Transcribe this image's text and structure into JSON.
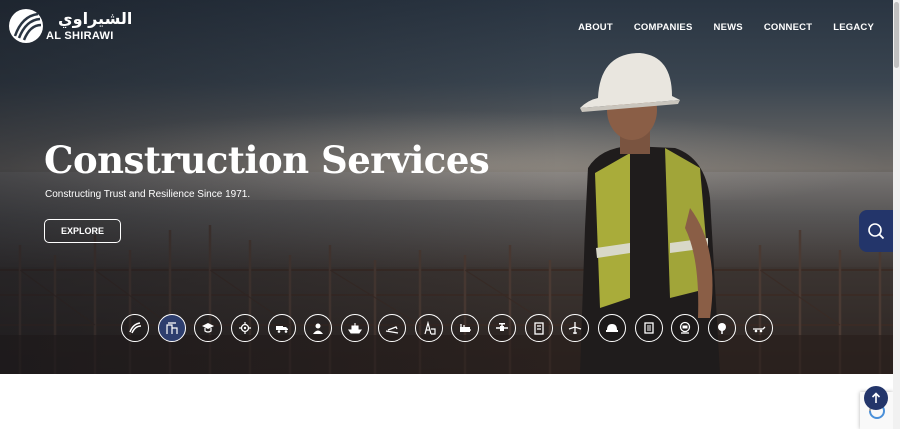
{
  "brand": {
    "name": "AL SHIRAWI",
    "name_arabic": "الشيراوي"
  },
  "nav": {
    "items": [
      "ABOUT",
      "COMPANIES",
      "NEWS",
      "CONNECT",
      "LEGACY"
    ]
  },
  "hero": {
    "title": "Construction Services",
    "subtitle": "Constructing Trust and Resilience Since 1971.",
    "cta_label": "EXPLORE"
  },
  "categories": {
    "active_index": 1,
    "icons": [
      "brand-swoosh-icon",
      "construction-site-icon",
      "graduation-cap-icon",
      "gear-chip-icon",
      "truck-icon",
      "worker-icon",
      "ship-icon",
      "tanker-icon",
      "oil-rig-icon",
      "engine-icon",
      "valve-icon",
      "building-icon",
      "plane-icon",
      "helmet-icon",
      "storage-icon",
      "diver-icon",
      "tree-icon",
      "trailer-icon"
    ]
  },
  "colors": {
    "accent_navy": "#23356a",
    "active_icon_bg": "#2d3e6e",
    "text_white": "#ffffff"
  }
}
